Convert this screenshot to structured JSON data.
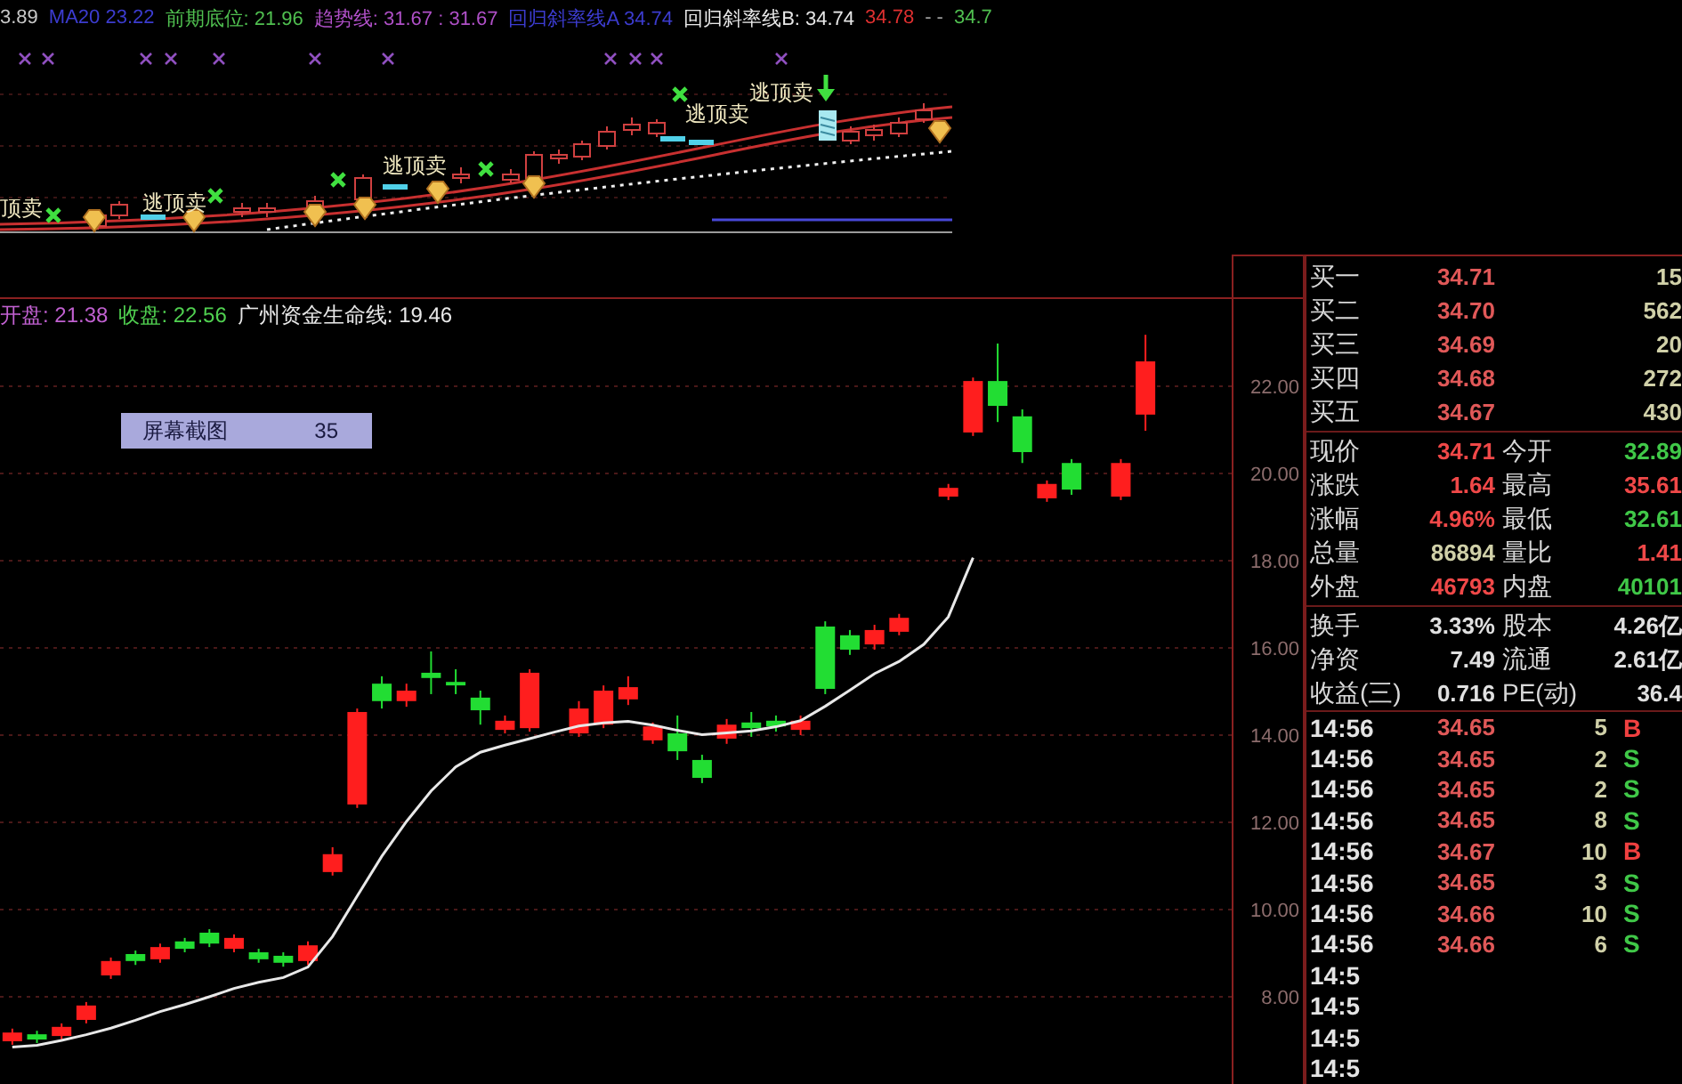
{
  "indicator_panel": {
    "legend": [
      {
        "text": "3.89",
        "color": "#c8c8c8"
      },
      {
        "text": "MA20 23.22",
        "color": "#3c3cd0"
      },
      {
        "text": "前期底位: 21.96",
        "color": "#50c050"
      },
      {
        "text": "趋势线: 31.67 : 31.67",
        "color": "#b050c8"
      },
      {
        "text": "回归斜率线A 34.74",
        "color": "#3c3cd0"
      },
      {
        "text": "回归斜率线B: 34.74",
        "color": "#e8e8e8"
      },
      {
        "text": "34.78",
        "color": "#e03030"
      },
      {
        "text": "- -",
        "color": "#a0a0a0"
      },
      {
        "text": "34.7",
        "color": "#50c050"
      }
    ],
    "signals": [
      {
        "text": "顶卖"
      },
      {
        "text": "逃顶卖"
      },
      {
        "text": "逃顶卖"
      },
      {
        "text": "逃顶卖"
      },
      {
        "text": "逃顶卖"
      }
    ]
  },
  "main_chart": {
    "legend": [
      {
        "text": "开盘: 21.38",
        "color": "#c060d0"
      },
      {
        "text": "收盘: 22.56",
        "color": "#50d050"
      },
      {
        "text": "广州资金生命线: 19.46",
        "color": "#e8e8e8"
      }
    ],
    "tooltip": {
      "label": "屏幕截图",
      "value": "35"
    },
    "chart_data": {
      "type": "candlestick",
      "grid": true,
      "categories": [
        null,
        null,
        null,
        null,
        null,
        null,
        null,
        null,
        null,
        null,
        null,
        null,
        null,
        null,
        null,
        null,
        null,
        null,
        null,
        null,
        null,
        null,
        null,
        null,
        null,
        null,
        null,
        null,
        null,
        null,
        null,
        null,
        null,
        null,
        null,
        null,
        null,
        null,
        null,
        null,
        null,
        null,
        null,
        null,
        null,
        null,
        null,
        null,
        null,
        null
      ],
      "ohlc": [
        [
          6.98,
          7.27,
          6.9,
          7.18
        ],
        [
          7.14,
          7.22,
          6.94,
          7.02
        ],
        [
          7.1,
          7.39,
          7.02,
          7.31
        ],
        [
          7.47,
          7.88,
          7.39,
          7.8
        ],
        [
          8.49,
          8.9,
          8.41,
          8.82
        ],
        [
          8.98,
          9.06,
          8.73,
          8.82
        ],
        [
          8.86,
          9.22,
          8.78,
          9.14
        ],
        [
          9.27,
          9.35,
          9.02,
          9.1
        ],
        [
          9.47,
          9.55,
          9.14,
          9.22
        ],
        [
          9.1,
          9.43,
          9.02,
          9.35
        ],
        [
          9.02,
          9.1,
          8.78,
          8.86
        ],
        [
          8.94,
          9.02,
          8.69,
          8.78
        ],
        [
          8.82,
          9.27,
          8.73,
          9.18
        ],
        [
          10.86,
          11.43,
          10.78,
          11.27
        ],
        [
          12.41,
          14.61,
          12.33,
          14.53
        ],
        [
          15.18,
          15.35,
          14.61,
          14.78
        ],
        [
          14.78,
          15.18,
          14.65,
          15.02
        ],
        [
          15.43,
          15.92,
          14.94,
          15.31
        ],
        [
          15.22,
          15.51,
          14.94,
          15.14
        ],
        [
          14.86,
          15.02,
          14.24,
          14.57
        ],
        [
          14.12,
          14.45,
          14.04,
          14.33
        ],
        [
          14.16,
          15.51,
          14.08,
          15.43
        ],
        null,
        [
          14.04,
          14.78,
          13.96,
          14.61
        ],
        [
          14.24,
          15.14,
          14.16,
          15.02
        ],
        [
          14.82,
          15.35,
          14.69,
          15.1
        ],
        [
          13.88,
          14.29,
          13.8,
          14.2
        ],
        [
          14.04,
          14.45,
          13.43,
          13.63
        ],
        [
          13.43,
          13.55,
          12.9,
          13.02
        ],
        [
          13.92,
          14.37,
          13.8,
          14.24
        ],
        [
          14.29,
          14.53,
          13.96,
          14.16
        ],
        [
          14.33,
          14.45,
          14.08,
          14.2
        ],
        [
          14.12,
          14.45,
          14.0,
          14.33
        ],
        [
          16.49,
          16.61,
          14.94,
          15.06
        ],
        [
          16.29,
          16.41,
          15.84,
          15.96
        ],
        [
          16.08,
          16.53,
          15.96,
          16.41
        ],
        [
          16.37,
          16.78,
          16.29,
          16.69
        ],
        null,
        [
          19.47,
          19.76,
          19.39,
          19.67
        ],
        [
          20.94,
          22.2,
          20.86,
          22.12
        ],
        [
          22.12,
          22.98,
          21.18,
          21.55
        ],
        [
          21.31,
          21.47,
          20.24,
          20.49
        ],
        [
          19.43,
          19.84,
          19.35,
          19.76
        ],
        [
          20.24,
          20.33,
          19.51,
          19.63
        ],
        null,
        [
          19.47,
          20.33,
          19.39,
          20.24
        ],
        [
          21.35,
          23.18,
          20.98,
          22.57
        ],
        null,
        null,
        null
      ],
      "series": [
        {
          "type": "line",
          "color": "#e8e8e8",
          "values": [
            6.85,
            6.89,
            7.0,
            7.13,
            7.28,
            7.46,
            7.66,
            7.82,
            8.0,
            8.19,
            8.33,
            8.44,
            8.68,
            9.38,
            10.31,
            11.22,
            12.02,
            12.72,
            13.27,
            13.61,
            13.77,
            13.92,
            14.07,
            14.21,
            14.28,
            14.32,
            14.23,
            14.11,
            14.01,
            14.05,
            14.1,
            14.19,
            14.33,
            14.66,
            15.03,
            15.41,
            15.69,
            16.08,
            16.71,
            18.07,
            null,
            null,
            null,
            null,
            null,
            null,
            null,
            null,
            null,
            null
          ]
        }
      ],
      "ylim": [
        6,
        24
      ],
      "yticks": [
        {
          "value": 22,
          "label": "22.00"
        },
        {
          "value": 20,
          "label": "20.00"
        },
        {
          "value": 18,
          "label": "18.00"
        },
        {
          "value": 16,
          "label": "16.00"
        },
        {
          "value": 14,
          "label": "14.00"
        },
        {
          "value": 12,
          "label": "12.00"
        },
        {
          "value": 10,
          "label": "10.00"
        },
        {
          "value": 8,
          "label": "8.00"
        }
      ]
    }
  },
  "quote_panel": {
    "bids": [
      {
        "label": "买一",
        "price": "34.71",
        "volume": "15"
      },
      {
        "label": "买二",
        "price": "34.70",
        "volume": "562"
      },
      {
        "label": "买三",
        "price": "34.69",
        "volume": "20"
      },
      {
        "label": "买四",
        "price": "34.68",
        "volume": "272"
      },
      {
        "label": "买五",
        "price": "34.67",
        "volume": "430"
      }
    ],
    "stats": [
      {
        "label": "现价",
        "value": "34.71",
        "color": "#f04848"
      },
      {
        "label": "今开",
        "value": "32.89",
        "color": "#40c848"
      },
      {
        "label": "涨跌",
        "value": "1.64",
        "color": "#f04848"
      },
      {
        "label": "最高",
        "value": "35.61",
        "color": "#f04848"
      },
      {
        "label": "涨幅",
        "value": "4.96%",
        "color": "#f04848"
      },
      {
        "label": "最低",
        "value": "32.61",
        "color": "#40c848"
      },
      {
        "label": "总量",
        "value": "86894",
        "color": "#d0d0a8"
      },
      {
        "label": "量比",
        "value": "1.41",
        "color": "#f04848"
      },
      {
        "label": "外盘",
        "value": "46793",
        "color": "#f04848"
      },
      {
        "label": "内盘",
        "value": "40101",
        "color": "#40c848"
      }
    ],
    "fundamentals": [
      {
        "label": "换手",
        "value": "3.33%"
      },
      {
        "label": "股本",
        "value": "4.26亿"
      },
      {
        "label": "净资",
        "value": "7.49"
      },
      {
        "label": "流通",
        "value": "2.61亿"
      },
      {
        "label": "收益(三)",
        "value": "0.716"
      },
      {
        "label": "PE(动)",
        "value": "36.4"
      }
    ],
    "ticks": [
      {
        "time": "14:56",
        "price": "34.65",
        "volume": "5",
        "side": "B",
        "kind": "buy"
      },
      {
        "time": "14:56",
        "price": "34.65",
        "volume": "2",
        "side": "S",
        "kind": "sell"
      },
      {
        "time": "14:56",
        "price": "34.65",
        "volume": "2",
        "side": "S",
        "kind": "sell"
      },
      {
        "time": "14:56",
        "price": "34.65",
        "volume": "8",
        "side": "S",
        "kind": "sell"
      },
      {
        "time": "14:56",
        "price": "34.67",
        "volume": "10",
        "side": "B",
        "kind": "buy"
      },
      {
        "time": "14:56",
        "price": "34.65",
        "volume": "3",
        "side": "S",
        "kind": "sell"
      },
      {
        "time": "14:56",
        "price": "34.66",
        "volume": "10",
        "side": "S",
        "kind": "sell"
      },
      {
        "time": "14:56",
        "price": "34.66",
        "volume": "6",
        "side": "S",
        "kind": "sell"
      },
      {
        "time": "14:5"
      },
      {
        "time": "14:5"
      },
      {
        "time": "14:5"
      },
      {
        "time": "14:5"
      }
    ]
  }
}
